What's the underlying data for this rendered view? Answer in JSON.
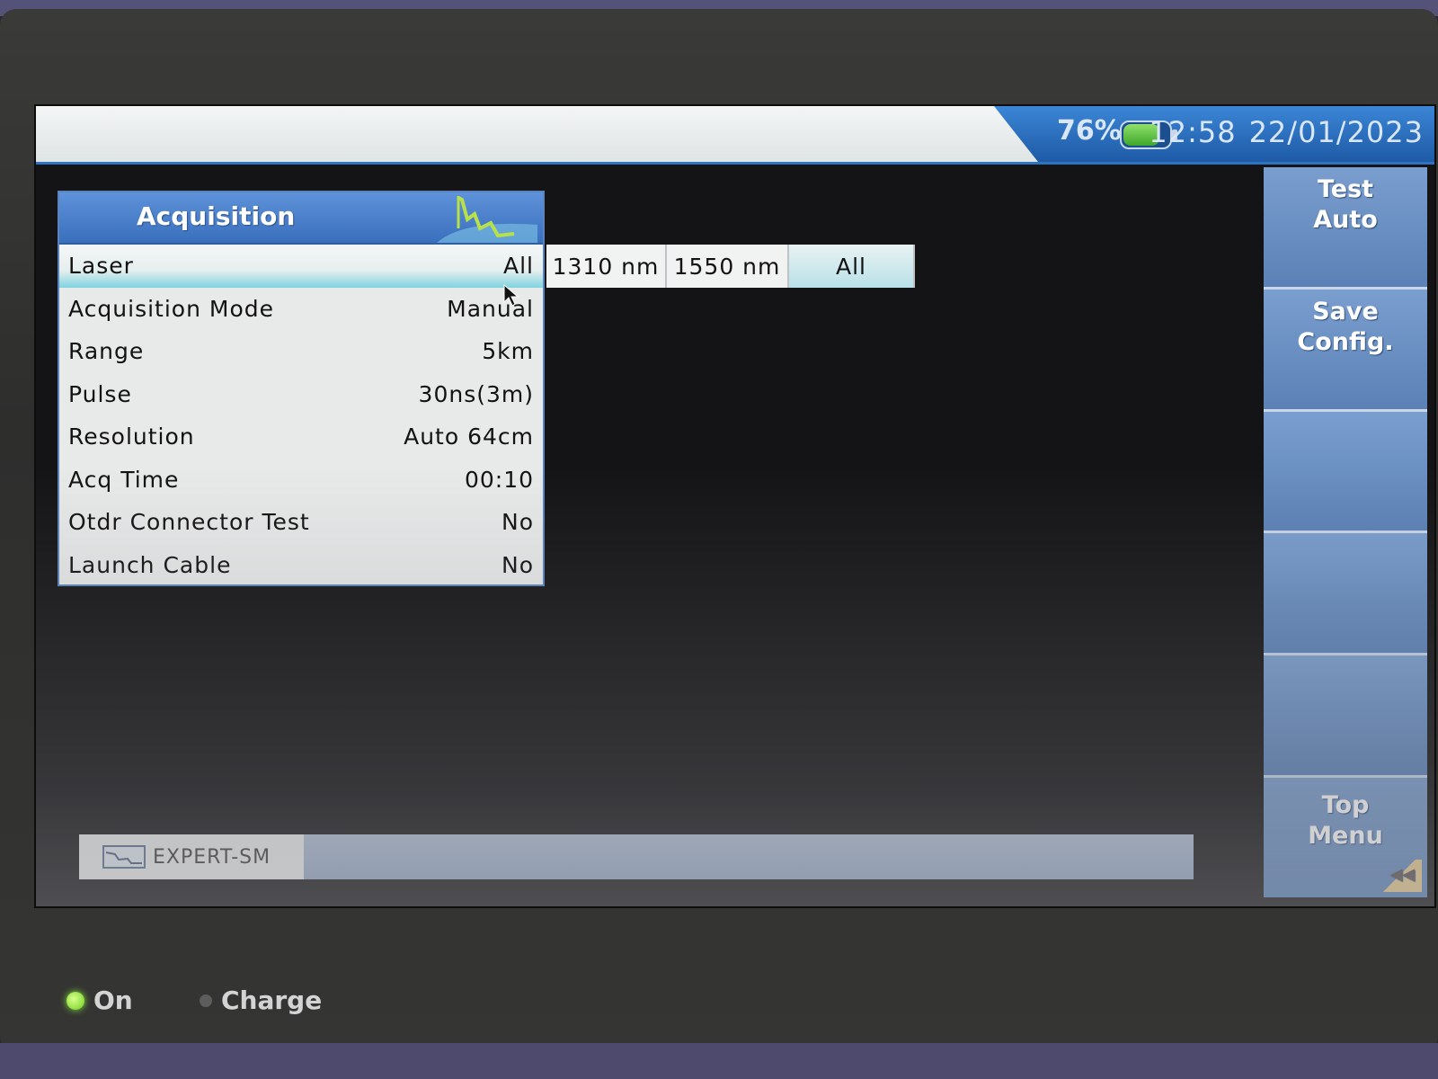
{
  "status_bar": {
    "battery_percent": "76%",
    "time": "12:58",
    "date": "22/01/2023"
  },
  "softkeys": {
    "test_auto": "Test\nAuto",
    "save_config": "Save\nConfig.",
    "top_menu": "Top\nMenu"
  },
  "panel": {
    "title": "Acquisition",
    "rows": [
      {
        "label": "Laser",
        "value": "All"
      },
      {
        "label": "Acquisition Mode",
        "value": "Manual"
      },
      {
        "label": "Range",
        "value": "5km"
      },
      {
        "label": "Pulse",
        "value": "30ns(3m)"
      },
      {
        "label": "Resolution",
        "value": "Auto 64cm"
      },
      {
        "label": "Acq Time",
        "value": "00:10"
      },
      {
        "label": "Otdr Connector Test",
        "value": "No"
      },
      {
        "label": "Launch Cable",
        "value": "No"
      }
    ]
  },
  "laser_options": [
    "1310 nm",
    "1550 nm",
    "All"
  ],
  "laser_selected": "All",
  "taskbar": {
    "tab_label": "EXPERT-SM"
  },
  "leds": {
    "on_label": "On",
    "charge_label": "Charge"
  },
  "colors": {
    "accent_blue": "#3a6fbd",
    "selection_cyan": "#7fd4e0",
    "led_on": "#6ccf1f"
  }
}
